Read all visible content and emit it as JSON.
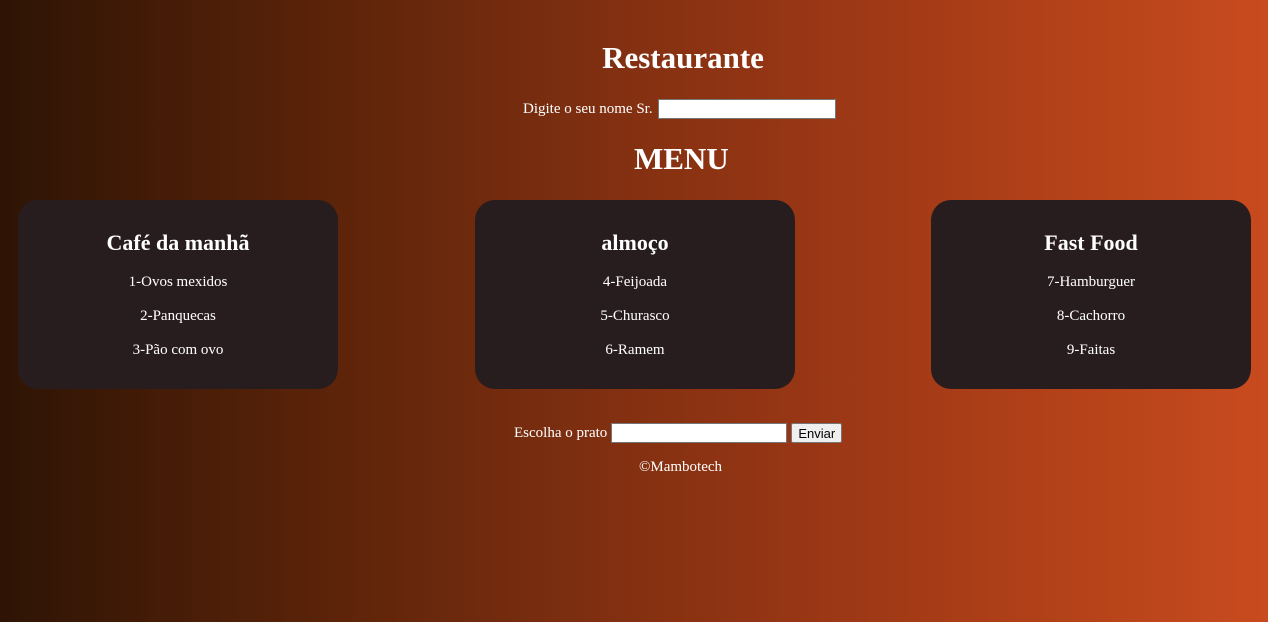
{
  "header": {
    "title": "Restaurante"
  },
  "name_prompt": {
    "label": "Digite o seu nome Sr.",
    "value": "",
    "placeholder": ""
  },
  "menu": {
    "title": "MENU",
    "cards": [
      {
        "title": "Café da manhã",
        "items": [
          "1-Ovos mexidos",
          "2-Panquecas",
          "3-Pão com ovo"
        ]
      },
      {
        "title": "almoço",
        "items": [
          "4-Feijoada",
          "5-Churasco",
          "6-Ramem"
        ]
      },
      {
        "title": "Fast Food",
        "items": [
          "7-Hamburguer",
          "8-Cachorro",
          "9-Faitas"
        ]
      }
    ]
  },
  "order": {
    "label": "Escolha o prato",
    "value": "",
    "placeholder": "",
    "submit_label": "Enviar"
  },
  "footer": {
    "text": "©Mambotech"
  },
  "colors": {
    "card_background": "#281d1e",
    "gradient_start": "#2e1405",
    "gradient_end": "#c84b1f"
  }
}
